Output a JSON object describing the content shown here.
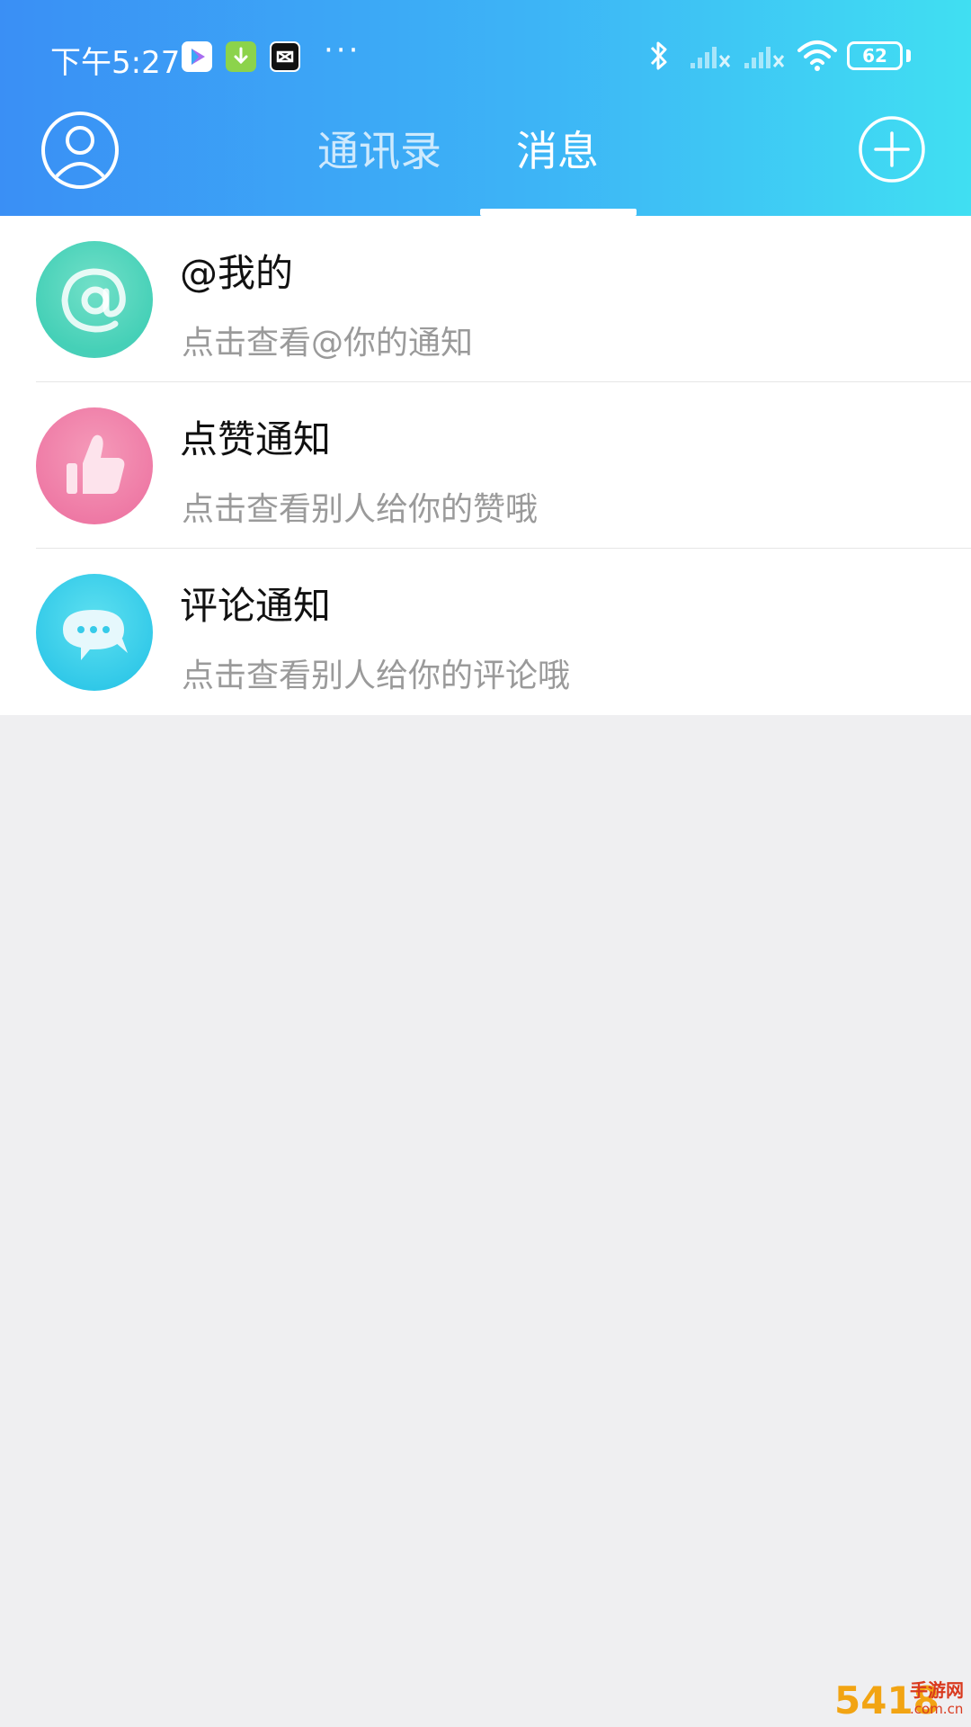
{
  "status_bar": {
    "time": "下午5:27",
    "more": "···",
    "battery": "62"
  },
  "nav": {
    "tabs": [
      {
        "label": "通讯录",
        "active": false
      },
      {
        "label": "消息",
        "active": true
      }
    ]
  },
  "messages": [
    {
      "icon": "at-icon",
      "title": "@我的",
      "subtitle": "点击查看@你的通知",
      "color": "#4fd3bd"
    },
    {
      "icon": "thumbs-up-icon",
      "title": "点赞通知",
      "subtitle": "点击查看别人给你的赞哦",
      "color": "#f081aa"
    },
    {
      "icon": "chat-bubble-icon",
      "title": "评论通知",
      "subtitle": "点击查看别人给你的评论哦",
      "color": "#36cbe9"
    }
  ],
  "watermark": {
    "logo_number": "5418",
    "text": "手游网",
    "domain": ".com.cn"
  },
  "colors": {
    "header_start": "#3a8ff5",
    "header_end": "#40dff2",
    "background": "#efeff1"
  }
}
